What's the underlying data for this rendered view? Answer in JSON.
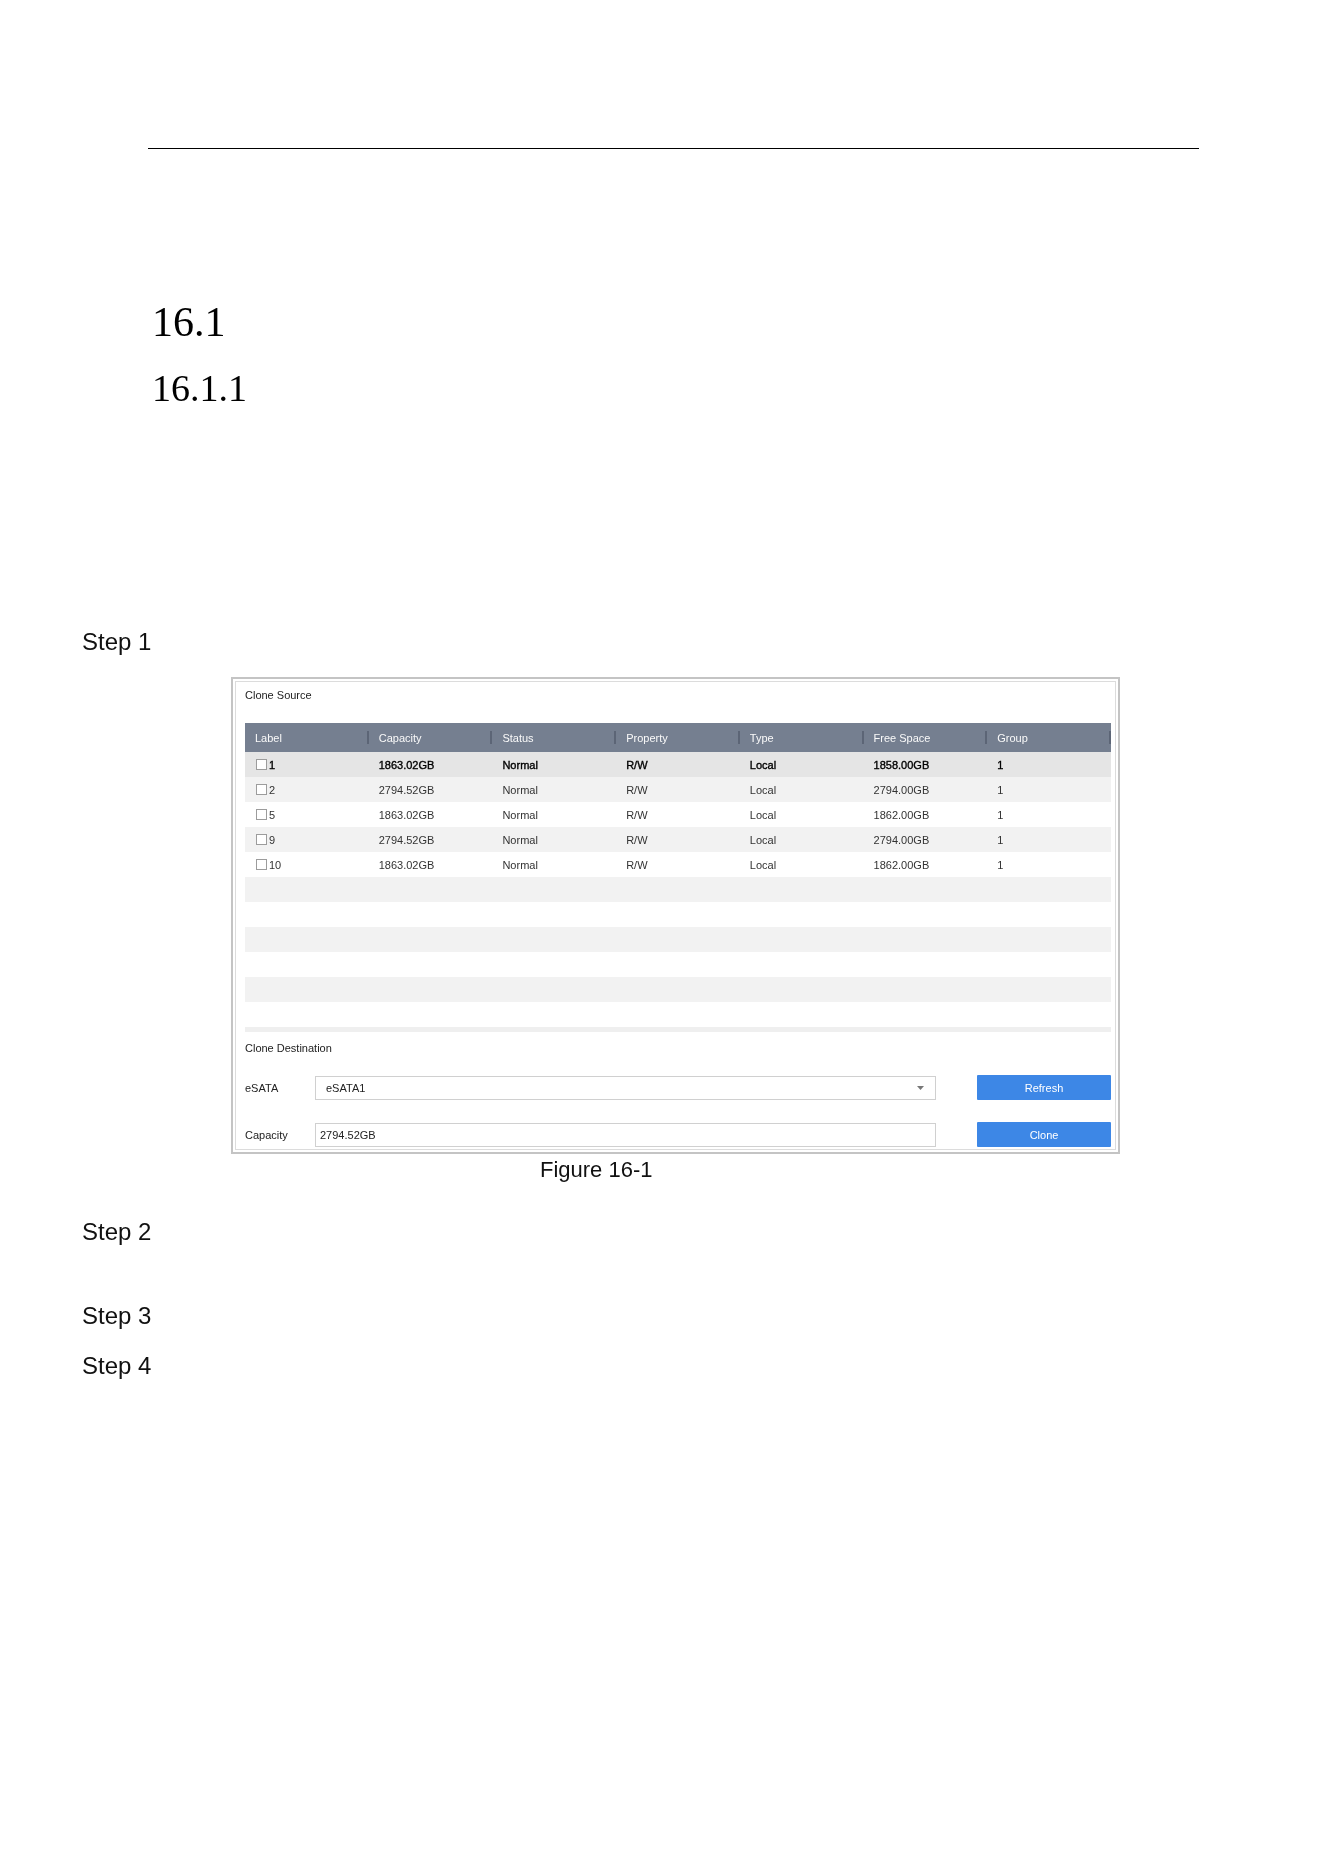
{
  "headings": [
    {
      "kind": "section",
      "text": "16.1"
    },
    {
      "kind": "subsection",
      "text": "16.1.1"
    }
  ],
  "steps": [
    {
      "label": "Step 1",
      "figure": {
        "clone_source": {
          "title": "Clone Source",
          "table": {
            "columns": [
              "Label",
              "Capacity",
              "Status",
              "Property",
              "Type",
              "Free Space",
              "Group"
            ],
            "rows": [
              {
                "selected": true,
                "checked": false,
                "cells": [
                  "1",
                  "1863.02GB",
                  "Normal",
                  "R/W",
                  "Local",
                  "1858.00GB",
                  "1"
                ]
              },
              {
                "selected": false,
                "checked": false,
                "cells": [
                  "2",
                  "2794.52GB",
                  "Normal",
                  "R/W",
                  "Local",
                  "2794.00GB",
                  "1"
                ]
              },
              {
                "selected": false,
                "checked": false,
                "cells": [
                  "5",
                  "1863.02GB",
                  "Normal",
                  "R/W",
                  "Local",
                  "1862.00GB",
                  "1"
                ]
              },
              {
                "selected": false,
                "checked": false,
                "cells": [
                  "9",
                  "2794.52GB",
                  "Normal",
                  "R/W",
                  "Local",
                  "2794.00GB",
                  "1"
                ]
              },
              {
                "selected": false,
                "checked": false,
                "cells": [
                  "10",
                  "1863.02GB",
                  "Normal",
                  "R/W",
                  "Local",
                  "1862.00GB",
                  "1"
                ]
              }
            ]
          }
        },
        "clone_destination": {
          "title": "Clone Destination",
          "fields": [
            {
              "kind": "dropdown",
              "label": "eSATA",
              "value": "eSATA1",
              "button": "Refresh"
            },
            {
              "kind": "text",
              "label": "Capacity",
              "value": "2794.52GB",
              "button": "Clone"
            }
          ]
        },
        "caption": "Figure 16-1"
      }
    },
    {
      "label": "Step 2"
    },
    {
      "label": "Step 3"
    },
    {
      "label": "Step 4"
    }
  ]
}
